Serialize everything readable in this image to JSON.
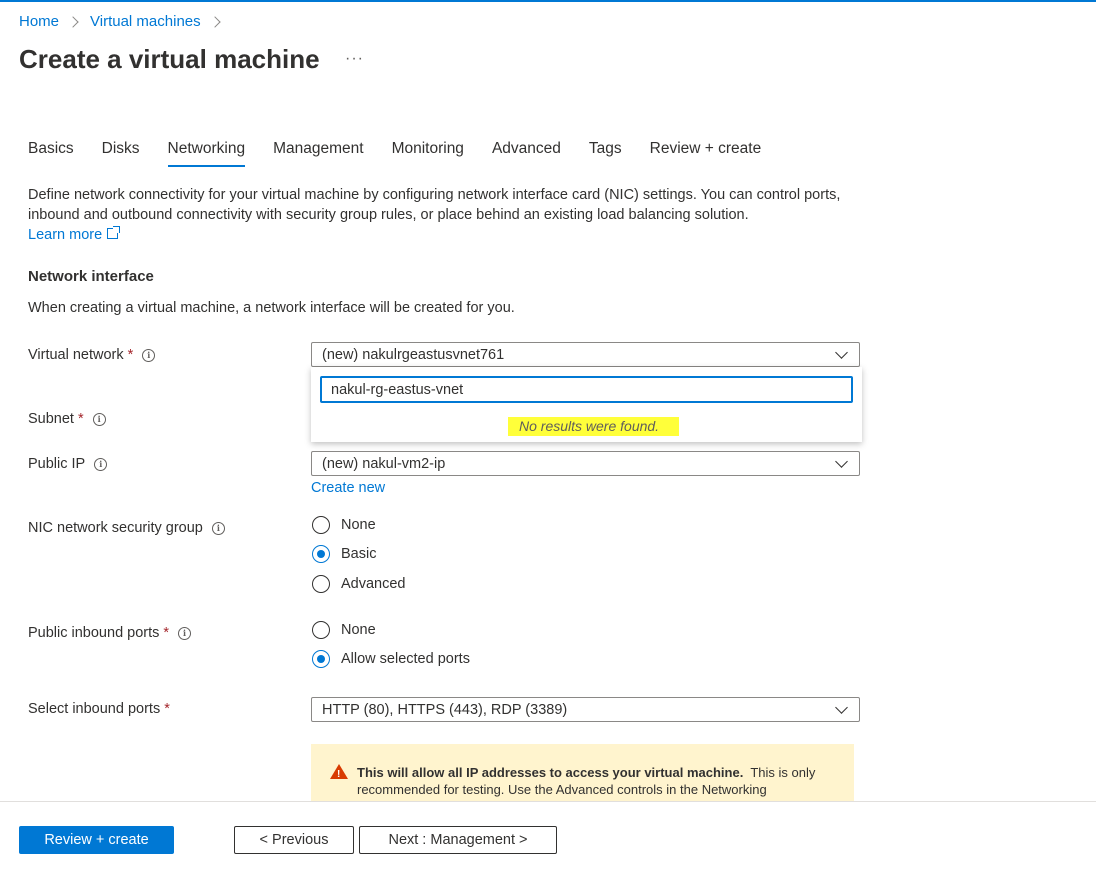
{
  "breadcrumb": {
    "home": "Home",
    "vms": "Virtual machines"
  },
  "page": {
    "title": "Create a virtual machine",
    "more": "···"
  },
  "tabs": [
    "Basics",
    "Disks",
    "Networking",
    "Management",
    "Monitoring",
    "Advanced",
    "Tags",
    "Review + create"
  ],
  "intro": {
    "text": "Define network connectivity for your virtual machine by configuring network interface card (NIC) settings. You can control ports, inbound and outbound connectivity with security group rules, or place behind an existing load balancing solution.",
    "learn_more": "Learn more"
  },
  "network_interface": {
    "heading": "Network interface",
    "subtext": "When creating a virtual machine, a network interface will be created for you."
  },
  "fields": {
    "virtual_network": {
      "label": "Virtual network",
      "value": "(new) nakulrgeastusvnet761"
    },
    "subnet": {
      "label": "Subnet"
    },
    "public_ip": {
      "label": "Public IP",
      "value": "(new) nakul-vm2-ip",
      "create_new": "Create new"
    },
    "nic_nsg": {
      "label": "NIC network security group",
      "options": [
        "None",
        "Basic",
        "Advanced"
      ],
      "selected": "Basic"
    },
    "public_inbound": {
      "label": "Public inbound ports",
      "options": [
        "None",
        "Allow selected ports"
      ],
      "selected": "Allow selected ports"
    },
    "select_inbound": {
      "label": "Select inbound ports",
      "value": "HTTP (80), HTTPS (443), RDP (3389)"
    }
  },
  "required_mark": "*",
  "vnet_popup": {
    "search_value": "nakul-rg-eastus-vnet",
    "no_results": "No results were found."
  },
  "warning": {
    "bold": "This will allow all IP addresses to access your virtual machine.",
    "text": "This is only recommended for testing.  Use the Advanced controls in the Networking"
  },
  "footer": {
    "review_create": "Review + create",
    "previous": "< Previous",
    "next": "Next : Management >"
  },
  "colors": {
    "accent": "#0078d4",
    "highlight": "#ffff3a",
    "warning_bg": "#fff4ce",
    "required": "#a4262c"
  }
}
